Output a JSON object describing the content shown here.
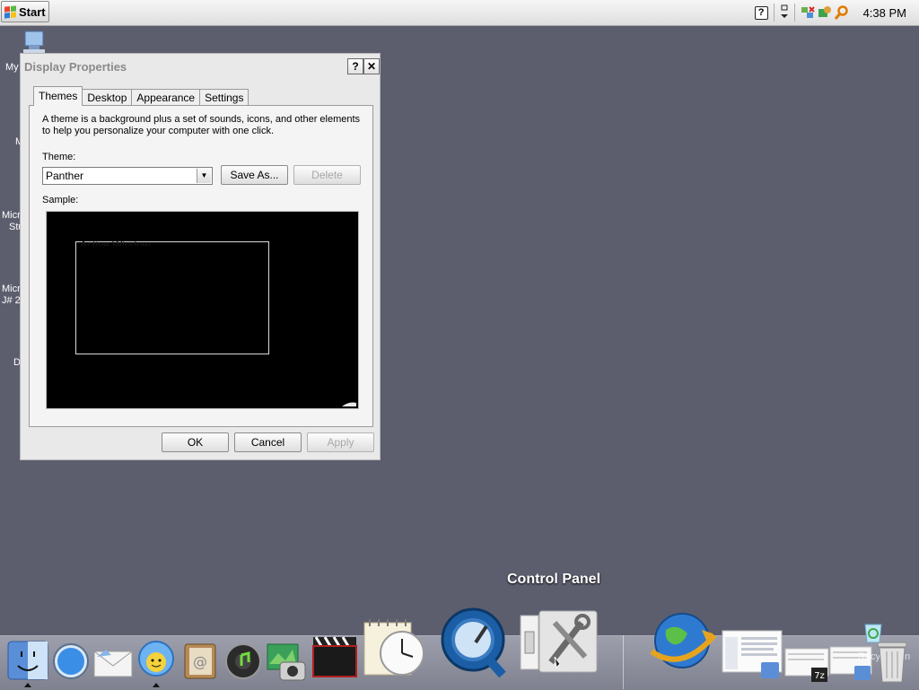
{
  "taskbar": {
    "start_label": "Start",
    "clock": "4:38 PM",
    "tray_icons": [
      "help-icon",
      "network-arrow-icon",
      "network-icon",
      "security-icon",
      "search-icon"
    ]
  },
  "desktop": {
    "icon_labels": [
      "My",
      "M",
      "Micro",
      "Stu",
      "Micro",
      "J# 2",
      "D"
    ]
  },
  "dialog": {
    "title": "Display Properties",
    "help_button": "?",
    "close_button": "✕",
    "tabs": [
      {
        "label": "Themes",
        "active": true
      },
      {
        "label": "Desktop",
        "active": false
      },
      {
        "label": "Appearance",
        "active": false
      },
      {
        "label": "Settings",
        "active": false
      }
    ],
    "description": "A theme is a background plus a set of sounds, icons, and other elements to help you personalize your computer with one click.",
    "theme_label": "Theme:",
    "theme_value": "Panther",
    "save_as_label": "Save As...",
    "delete_label": "Delete",
    "sample_label": "Sample:",
    "sample_window_title": "Active Window",
    "ok_label": "OK",
    "cancel_label": "Cancel",
    "apply_label": "Apply"
  },
  "dock": {
    "tooltip": "Control Panel",
    "items": [
      "finder-icon",
      "safari-icon",
      "mail-icon",
      "ichat-icon",
      "address-book-icon",
      "itunes-icon",
      "iphoto-icon",
      "imovie-icon",
      "ical-clock-icon",
      "quicktime-icon",
      "system-preferences-icon",
      "internet-icon",
      "window-thumbnail-icon",
      "7zip-window-icon",
      "explorer-window-icon",
      "recycle-bin-icon",
      "trash-icon"
    ],
    "trash_label": "Recycle Bin"
  },
  "colors": {
    "desktop_bg": "#5c5e6e",
    "sample_bg": "#000000"
  }
}
